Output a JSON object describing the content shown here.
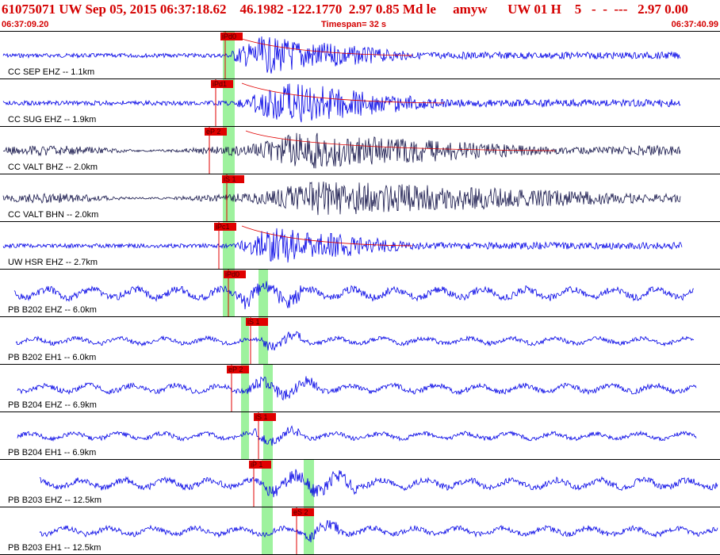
{
  "header": {
    "title": "61075071 UW Sep 05, 2015 06:37:18.62    46.1982 -122.1770  2.97 0.85 Md le     amyw      UW 01 H    5   -  -  ---   2.97 0.00",
    "start_time": "06:37:09.20",
    "timespan": "Timespan=  32 s",
    "end_time": "06:37:40.99"
  },
  "colors": {
    "title": "#d40000",
    "trace_blue": "#0000e6",
    "trace_dark": "#15154a",
    "pick": "#e00000",
    "window": "#9ef29e"
  },
  "channels": [
    {
      "label": "CC SEP EHZ -- 1.1km",
      "pick": "iPd0",
      "color": "blue",
      "style": "quake"
    },
    {
      "label": "CC SUG EHZ -- 1.9km",
      "pick": "iPd1",
      "color": "blue",
      "style": "quake"
    },
    {
      "label": "CC VALT BHZ -- 2.0km",
      "pick": "eP 2",
      "color": "dark",
      "style": "quake"
    },
    {
      "label": "CC VALT BHN -- 2.0km",
      "pick": "iS 1",
      "color": "dark",
      "style": "quake"
    },
    {
      "label": "UW HSR EHZ -- 2.7km",
      "pick": "iPc1",
      "color": "blue",
      "style": "quake"
    },
    {
      "label": "PB B202 EHZ -- 6.0km",
      "pick": "iPd0",
      "color": "blue",
      "style": "noisy"
    },
    {
      "label": "PB B202 EH1 -- 6.0km",
      "pick": "iS 1",
      "color": "blue",
      "style": "noisy"
    },
    {
      "label": "PB B204 EHZ -- 6.9km",
      "pick": "eP 2",
      "color": "blue",
      "style": "noisy"
    },
    {
      "label": "PB B204 EH1 -- 6.9km",
      "pick": "iS 1",
      "color": "blue",
      "style": "noisy"
    },
    {
      "label": "PB B203 EHZ -- 12.5km",
      "pick": "iP 1",
      "color": "blue",
      "style": "noisy"
    },
    {
      "label": "PB B203 EH1 -- 12.5km",
      "pick": "eS 2",
      "color": "blue",
      "style": "noisy"
    }
  ]
}
